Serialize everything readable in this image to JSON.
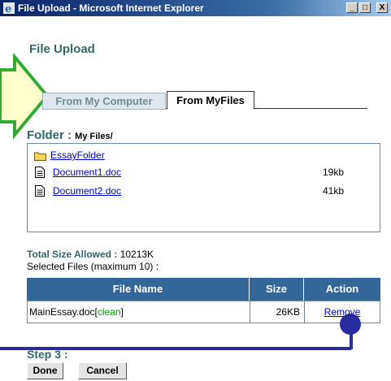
{
  "window": {
    "title": "File Upload - Microsoft Internet Explorer",
    "buttons": {
      "minimize": "_",
      "maximize": "□",
      "close": "X"
    }
  },
  "page_title": "File Upload",
  "tabs": [
    {
      "label": "From My Computer",
      "active": false
    },
    {
      "label": "From MyFiles",
      "active": true
    }
  ],
  "folder": {
    "label": "Folder :",
    "path": "My Files/",
    "items": [
      {
        "name": "EssayFolder",
        "type": "folder",
        "size": ""
      },
      {
        "name": "Document1.doc",
        "type": "file",
        "size": "19kb"
      },
      {
        "name": "Document2.doc",
        "type": "file",
        "size": "41kb"
      }
    ]
  },
  "totals": {
    "label": "Total Size Allowed :",
    "value": "10213K",
    "selected_label": "Selected Files (maximum 10) :"
  },
  "table": {
    "headers": [
      "File Name",
      "Size",
      "Action"
    ],
    "rows": [
      {
        "name": "MainEssay.doc",
        "status": "clean",
        "size": "26KB",
        "action": "Remove"
      }
    ]
  },
  "step_label": "Step 3 :",
  "buttons": {
    "done": "Done",
    "cancel": "Cancel"
  },
  "colors": {
    "accent_green_arrow": "#ffffcc",
    "arrow_border": "#33aa33",
    "header_blue": "#336699",
    "teal_text": "#336666",
    "callout": "#2b2ba0"
  }
}
